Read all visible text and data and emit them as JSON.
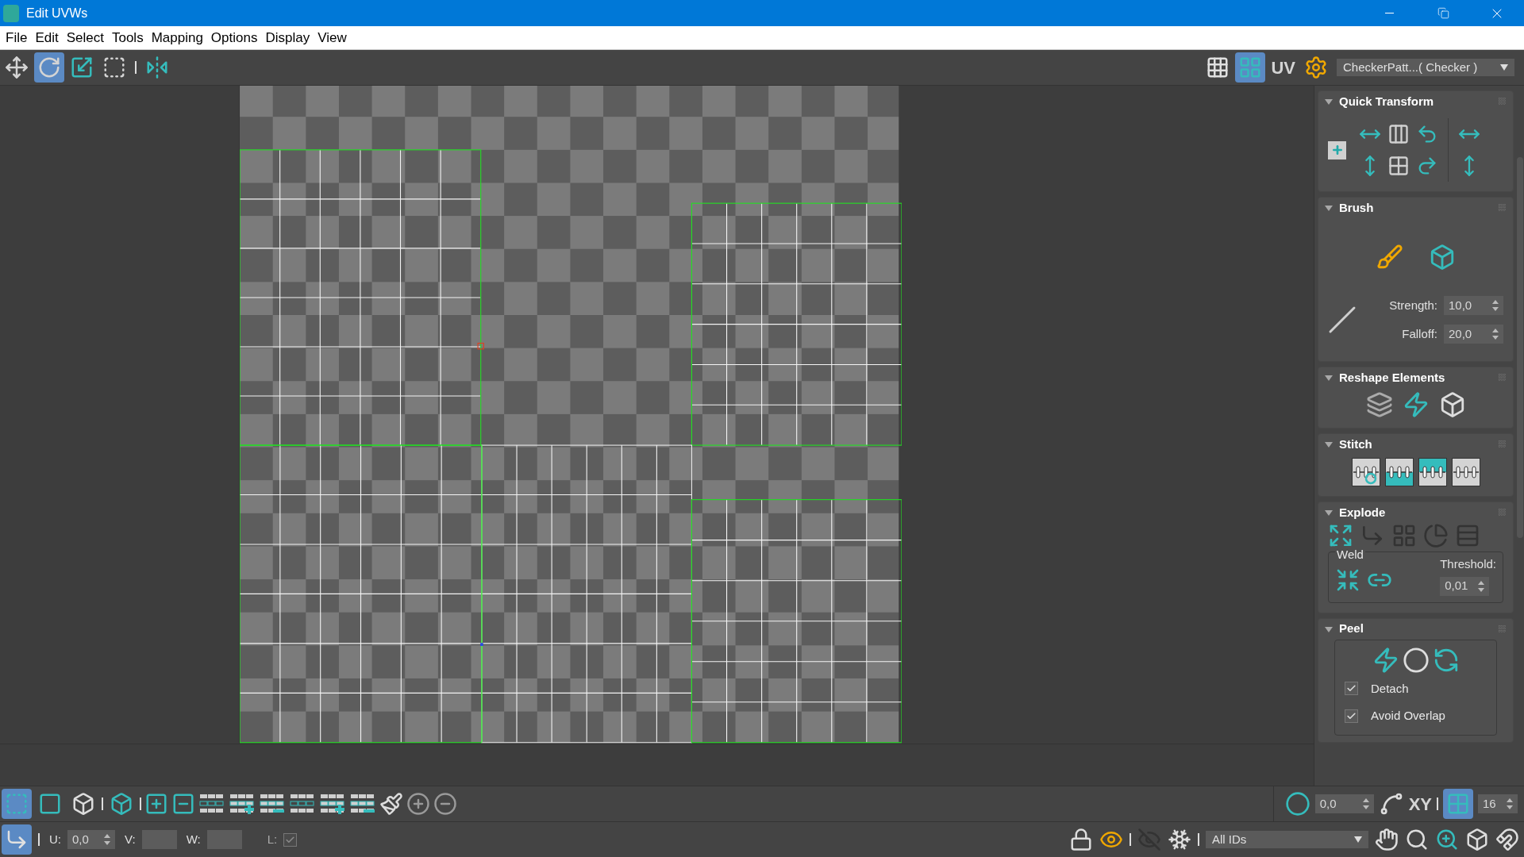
{
  "window": {
    "title": "Edit UVWs"
  },
  "menu": [
    "File",
    "Edit",
    "Select",
    "Tools",
    "Mapping",
    "Options",
    "Display",
    "View"
  ],
  "toolbar": {
    "tools": [
      {
        "selected": false
      },
      {
        "selected": true
      },
      {
        "selected": false
      },
      {
        "selected": false
      },
      {
        "selected": false
      }
    ],
    "display": [
      {
        "kind": "icon",
        "selected": false
      },
      {
        "kind": "icon",
        "selected": true
      },
      {
        "kind": "text",
        "label": "UV",
        "selected": false
      },
      {
        "kind": "icon",
        "selected": false
      }
    ],
    "texture": "CheckerPatt...( Checker )"
  },
  "panel": {
    "rollouts": [
      {
        "kind": "quick_transform",
        "title": "Quick Transform",
        "expanded": true
      },
      {
        "kind": "brush",
        "title": "Brush",
        "expanded": true,
        "fields": [
          {
            "label": "Strength:",
            "value": "10,0"
          },
          {
            "label": "Falloff:",
            "value": "20,0"
          }
        ]
      },
      {
        "kind": "reshape",
        "title": "Reshape Elements",
        "expanded": true
      },
      {
        "kind": "stitch",
        "title": "Stitch",
        "expanded": true
      },
      {
        "kind": "explode",
        "title": "Explode",
        "expanded": true,
        "weld": {
          "label": "Weld",
          "threshold_label": "Threshold:",
          "threshold": "0,01"
        }
      },
      {
        "kind": "peel",
        "title": "Peel",
        "expanded": true,
        "options": [
          {
            "label": "Detach",
            "checked": true
          },
          {
            "label": "Avoid Overlap",
            "checked": true
          }
        ]
      }
    ]
  },
  "bottom_toolbar": {
    "modes": [
      {
        "selected": true
      },
      {
        "selected": false
      },
      {
        "selected": false
      },
      {
        "selected": false
      }
    ],
    "soft_value": "0,0",
    "axis": "XY",
    "snap": {
      "selected": true
    },
    "snap_value": "16"
  },
  "status_bar": {
    "transform_mode": {
      "selected": true
    },
    "coords": [
      {
        "label": "U:",
        "value": "0,0"
      },
      {
        "label": "V:"
      },
      {
        "label": "W:"
      }
    ],
    "lock": {
      "label": "L:",
      "checked": true,
      "disabled": true
    },
    "id_filter": "All IDs"
  }
}
